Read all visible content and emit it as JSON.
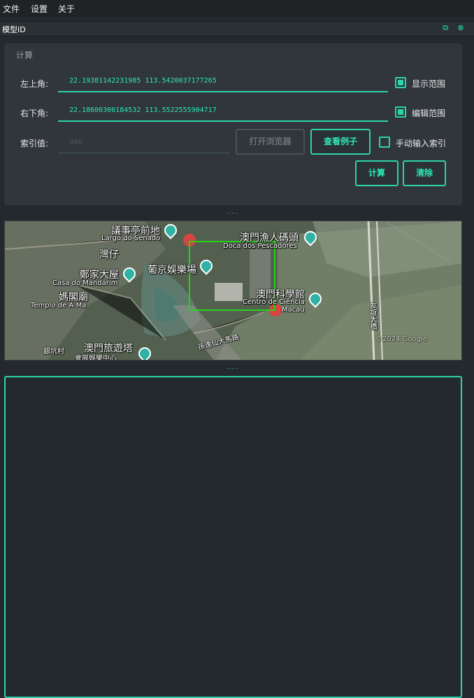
{
  "menu": {
    "items": [
      "文件",
      "设置",
      "关于"
    ]
  },
  "dock": {
    "title": "模型ID",
    "float_icon": "float-icon",
    "close_icon": "close-icon"
  },
  "calc_group": {
    "title": "计算",
    "top_left": {
      "label": "左上角:",
      "value": "22.19381142231985 113.5420037177265"
    },
    "bottom_right": {
      "label": "右下角:",
      "value": "22.18600300184532 113.5522555904717"
    },
    "index": {
      "label": "索引值:",
      "placeholder": "966"
    },
    "show_range": {
      "label": "显示范围",
      "checked": true
    },
    "edit_range": {
      "label": "编辑范围",
      "checked": true
    },
    "manual_index": {
      "label": "手动输入索引",
      "checked": false
    },
    "buttons": {
      "open_browser": "打开浏览器",
      "view_example": "查看例子",
      "calculate": "计算",
      "clear": "清除"
    }
  },
  "splitter": {
    "dots": "....."
  },
  "map": {
    "labels": {
      "senado_zh": "議事亭前地",
      "senado_pt": "Largo do Senado",
      "pescadores_zh": "澳門漁人碼頭",
      "pescadores_pt": "Doca dos Pescadores",
      "wanzai": "灣仔",
      "mandarim_zh": "鄭家大屋",
      "mandarim_pt": "Casa do Mandarim",
      "lisboa": "葡京娛樂場",
      "ama_zh": "媽閣廟",
      "ama_pt": "Templo de A-Ma",
      "ciencia_zh": "澳門科學館",
      "ciencia_pt": "Centro de Ciência",
      "macau": "Macau",
      "sai_van": "孫逸仙大馬路",
      "bridge": "友誼大橋",
      "yincun": "銀坑村",
      "tower_zh": "澳門旅遊塔",
      "tower_sub": "會展娛樂中心",
      "copyright": "©2024 Google"
    }
  },
  "colors": {
    "accent": "#2ed3a9",
    "background": "#24292d",
    "panel": "#30363b",
    "selection": "#25d418"
  }
}
